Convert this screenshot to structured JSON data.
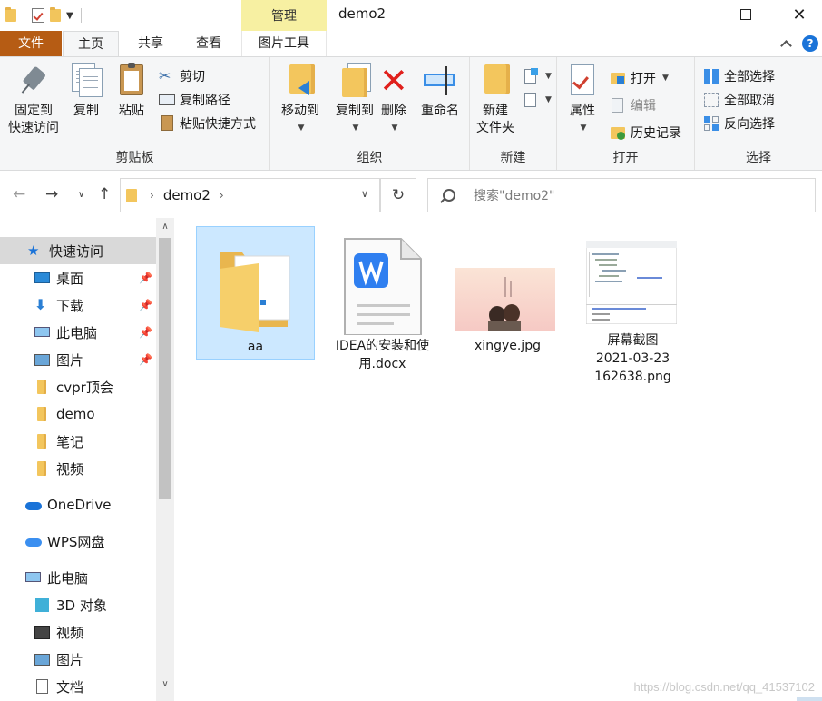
{
  "window": {
    "title": "demo2",
    "context_tab": "管理",
    "min_label": "",
    "max_label": "",
    "close_label": "✕"
  },
  "tabs": {
    "file": "文件",
    "home": "主页",
    "share": "共享",
    "view": "查看",
    "picture_tools": "图片工具",
    "help": "?"
  },
  "ribbon": {
    "clipboard": {
      "label": "剪贴板",
      "pin_quick_line1": "固定到",
      "pin_quick_line2": "快速访问",
      "copy": "复制",
      "paste": "粘贴",
      "cut": "剪切",
      "copy_path": "复制路径",
      "paste_shortcut": "粘贴快捷方式"
    },
    "organize": {
      "label": "组织",
      "move_to": "移动到",
      "copy_to": "复制到",
      "delete": "删除",
      "rename": "重命名"
    },
    "new": {
      "label": "新建",
      "new_folder_line1": "新建",
      "new_folder_line2": "文件夹"
    },
    "open": {
      "label": "打开",
      "properties": "属性",
      "open": "打开",
      "edit": "编辑",
      "history": "历史记录"
    },
    "select": {
      "label": "选择",
      "select_all": "全部选择",
      "select_none": "全部取消",
      "invert": "反向选择"
    }
  },
  "address": {
    "path": "demo2",
    "search_placeholder": "搜索\"demo2\""
  },
  "sidebar": {
    "quick_access": "快速访问",
    "items": [
      {
        "label": "桌面",
        "pinned": true
      },
      {
        "label": "下载",
        "pinned": true
      },
      {
        "label": "此电脑",
        "pinned": true
      },
      {
        "label": "图片",
        "pinned": true
      },
      {
        "label": "cvpr顶会",
        "pinned": false
      },
      {
        "label": "demo",
        "pinned": false
      },
      {
        "label": "笔记",
        "pinned": false
      },
      {
        "label": "视频",
        "pinned": false
      }
    ],
    "onedrive": "OneDrive",
    "wps": "WPS网盘",
    "this_pc": "此电脑",
    "pc_items": [
      "3D 对象",
      "视频",
      "图片",
      "文档"
    ]
  },
  "files": [
    {
      "name": "aa",
      "type": "folder",
      "selected": true
    },
    {
      "name": "IDEA的安装和使用.docx",
      "name_line1": "IDEA的安装和使",
      "name_line2": "用.docx",
      "type": "docx"
    },
    {
      "name": "xingye.jpg",
      "type": "image"
    },
    {
      "name": "屏幕截图 2021-03-23 162638.png",
      "name_line1": "屏幕截图",
      "name_line2": "2021-03-23",
      "name_line3": "162638.png",
      "type": "screenshot"
    }
  ],
  "watermark": "https://blog.csdn.net/qq_41537102",
  "colors": {
    "file_tab": "#b65c14",
    "context_tab": "#f7f0a2",
    "selection": "#cce8ff",
    "accent_blue": "#1a73d8"
  }
}
